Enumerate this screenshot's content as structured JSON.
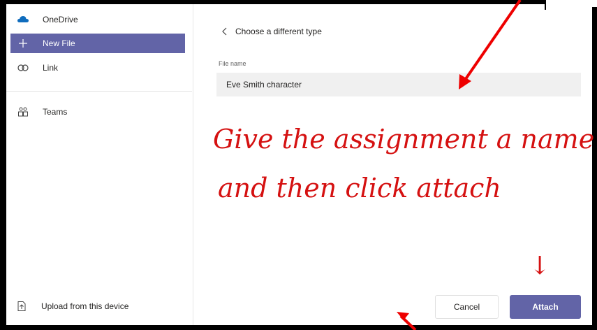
{
  "sidebar": {
    "items": [
      {
        "label": "OneDrive",
        "icon": "cloud-icon"
      },
      {
        "label": "New File",
        "icon": "plus-icon",
        "selected": true
      },
      {
        "label": "Link",
        "icon": "link-icon"
      },
      {
        "label": "Teams",
        "icon": "teams-icon"
      }
    ],
    "upload_label": "Upload from this device"
  },
  "main": {
    "back_label": "Choose a different type",
    "file_name_label": "File name",
    "file_name_value": "Eve Smith character",
    "cancel_label": "Cancel",
    "attach_label": "Attach"
  },
  "annotation": {
    "line1": "Give the assignment a name",
    "line2": "and then click attach",
    "arrow_glyph": "↓"
  },
  "colors": {
    "accent": "#6264a7",
    "annotation": "#d51111",
    "input_bg": "#f0f0f0"
  }
}
